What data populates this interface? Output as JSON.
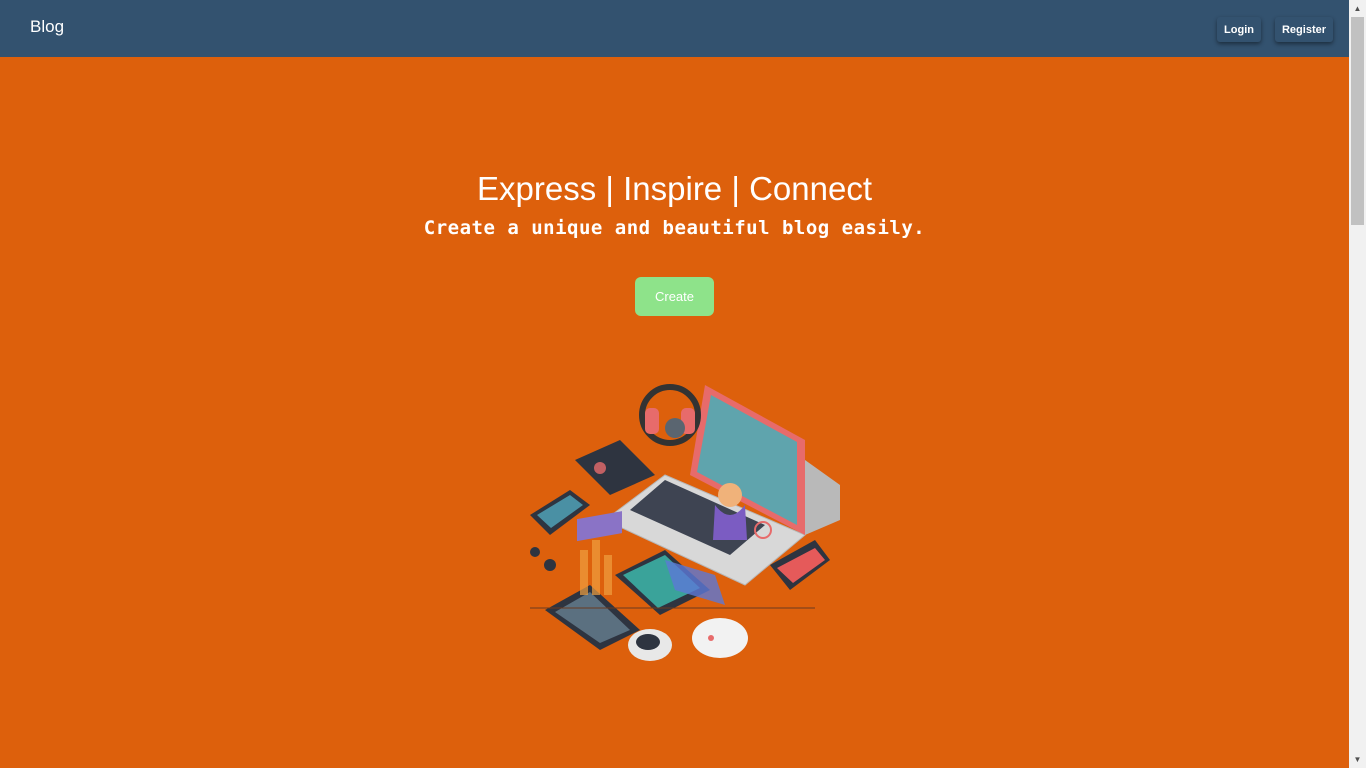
{
  "navbar": {
    "brand": "Blog",
    "login_label": "Login",
    "register_label": "Register"
  },
  "hero": {
    "title": "Express | Inspire | Connect",
    "subtitle": "Create a unique and beautiful blog easily.",
    "create_label": "Create"
  },
  "colors": {
    "navbar": "#33526f",
    "background": "#dd600c",
    "create_button": "#8ee38a"
  },
  "icons": {
    "scroll_up": "arrow-up-icon",
    "scroll_down": "arrow-down-icon"
  }
}
